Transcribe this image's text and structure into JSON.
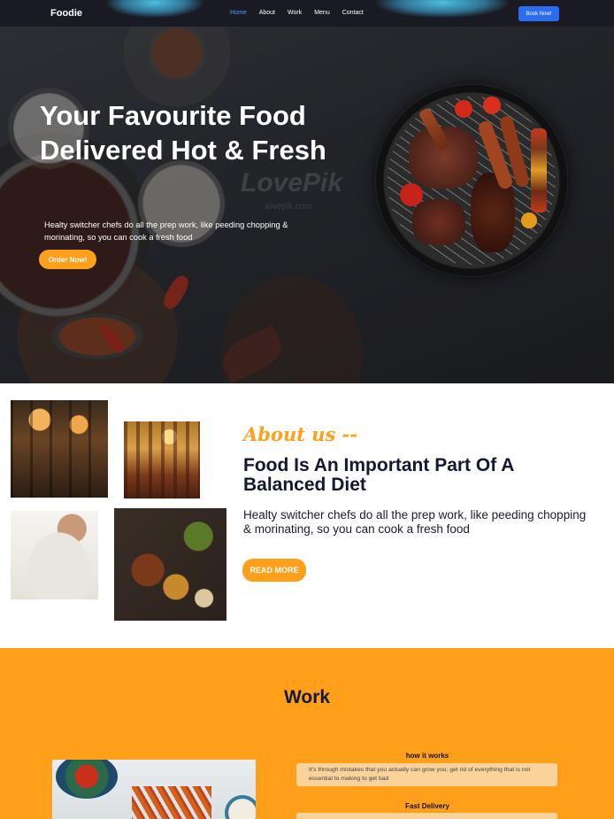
{
  "nav": {
    "brand": "Foodie",
    "links": [
      "Home",
      "About",
      "Work",
      "Menu",
      "Contact"
    ],
    "active": "Home",
    "cta": "Book Now!"
  },
  "hero": {
    "title": "Your Favourite Food Delivered Hot & Fresh",
    "text": "Healty switcher chefs do all the prep work, like peeding chopping & morinating, so you can cook a fresh food",
    "button": "Order Now!",
    "watermark": "LovePik",
    "watermark_sub": "lovepik.com"
  },
  "about": {
    "kicker": "About us --",
    "title": "Food Is An Important Part Of A Balanced Diet",
    "text_line1": "Healty switcher chefs do all the prep work, like peeding chopping",
    "text_line2": "& morinating, so you can cook a fresh food",
    "button": "READ MORE"
  },
  "work": {
    "title": "Work",
    "steps": [
      {
        "label": "how it works",
        "text": "It's through mistakes that you actually can grow you; get rid of everything that is not essential to making to get bad"
      },
      {
        "label": "Fast Delivery",
        "text": ""
      }
    ]
  },
  "colors": {
    "accent": "#ff9f1a",
    "nav_bg": "#1a1b22",
    "link_active": "#4a9bff",
    "cta_blue": "#2b6cf0",
    "heading_dark": "#141830"
  }
}
